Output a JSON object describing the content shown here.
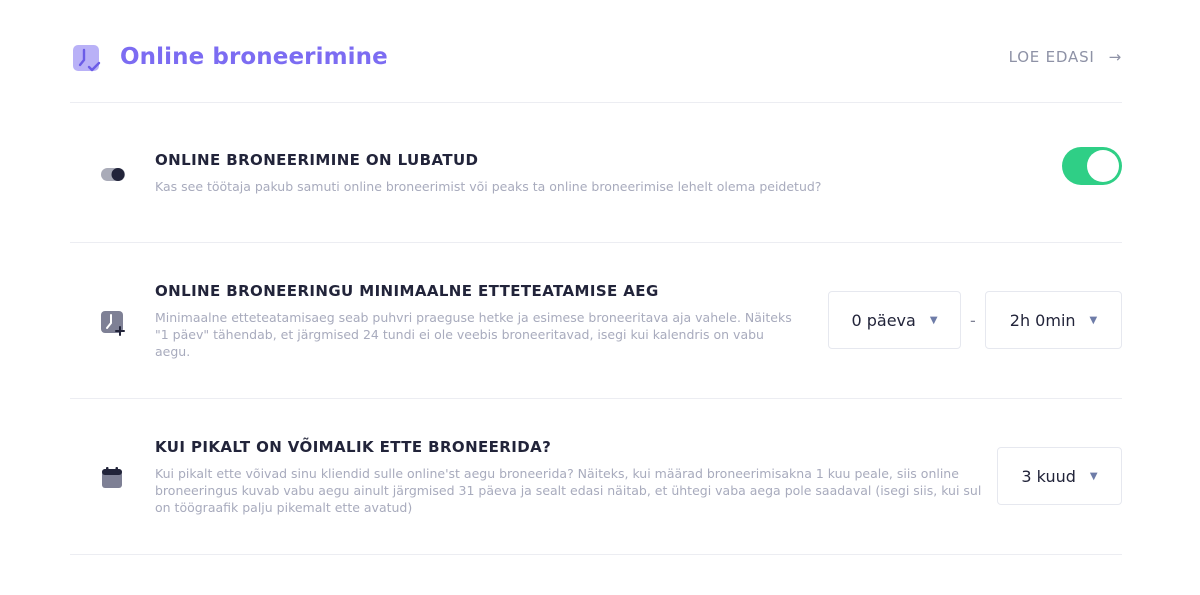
{
  "header": {
    "title": "Online broneerimine",
    "read_more": "LOE EDASI",
    "arrow": "→"
  },
  "settings": [
    {
      "title": "ONLINE BRONEERIMINE ON LUBATUD",
      "description": "Kas see töötaja pakub samuti online broneerimist või peaks ta online broneerimise lehelt olema peidetud?",
      "icon": "toggle-icon",
      "enabled": true
    },
    {
      "title": "ONLINE BRONEERINGU MINIMAALNE ETTETEATAMISE AEG",
      "description": "Minimaalne etteteatamisaeg seab puhvri praeguse hetke ja esimese broneeritava aja vahele. Näiteks \"1 päev\" tähendab, et järgmised 24 tundi ei ole veebis broneeritavad, isegi kui kalendris on vabu aegu.",
      "icon": "clock-plus-icon",
      "days_value": "0 päeva",
      "separator": "-",
      "time_value": "2h 0min"
    },
    {
      "title": "KUI PIKALT ON VÕIMALIK ETTE BRONEERIDA?",
      "description": "Kui pikalt ette võivad sinu kliendid sulle online'st aegu broneerida? Näiteks, kui määrad broneerimisakna 1 kuu peale, siis online broneeringus kuvab vabu aegu ainult järgmised 31 päeva ja sealt edasi näitab, et ühtegi vaba aega pole saadaval (isegi siis, kui sul on töögraafik palju pikemalt ette avatud)",
      "icon": "calendar-icon",
      "window_value": "3 kuud"
    }
  ],
  "colors": {
    "accent": "#7c6cf2",
    "toggle_on": "#2fcf86",
    "muted_text": "#a8abbd",
    "heading_text": "#22243a"
  },
  "caret": "▼"
}
